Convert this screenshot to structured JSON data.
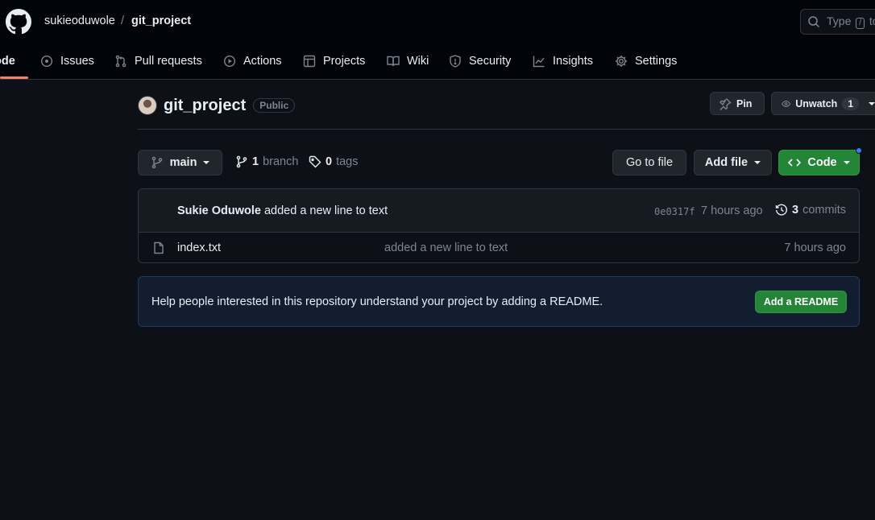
{
  "header": {
    "owner": "sukieoduwole",
    "separator": "/",
    "repo": "git_project",
    "search_prefix": "Type",
    "search_key": "/",
    "search_suffix": "to"
  },
  "nav": {
    "items": [
      {
        "label": "ode",
        "icon": "code-icon"
      },
      {
        "label": "Issues",
        "icon": "issue-icon"
      },
      {
        "label": "Pull requests",
        "icon": "pull-request-icon"
      },
      {
        "label": "Actions",
        "icon": "play-icon"
      },
      {
        "label": "Projects",
        "icon": "table-icon"
      },
      {
        "label": "Wiki",
        "icon": "book-icon"
      },
      {
        "label": "Security",
        "icon": "shield-icon"
      },
      {
        "label": "Insights",
        "icon": "graph-icon"
      },
      {
        "label": "Settings",
        "icon": "gear-icon"
      }
    ]
  },
  "repo_head": {
    "name": "git_project",
    "visibility": "Public",
    "pin_label": "Pin",
    "watch_label": "Unwatch",
    "watch_count": "1"
  },
  "toolbar": {
    "branch": "main",
    "branch_count": "1",
    "branch_label": "branch",
    "tag_count": "0",
    "tag_label": "tags",
    "go_to_file": "Go to file",
    "add_file": "Add file",
    "code": "Code"
  },
  "latest_commit": {
    "author": "Sukie Oduwole",
    "message": "added a new line to text",
    "sha": "0e0317f",
    "time": "7 hours ago",
    "count": "3",
    "count_label": "commits"
  },
  "files": [
    {
      "name": "index.txt",
      "message": "added a new line to text",
      "time": "7 hours ago"
    }
  ],
  "readme_banner": {
    "text": "Help people interested in this repository understand your project by adding a README.",
    "button": "Add a README"
  }
}
